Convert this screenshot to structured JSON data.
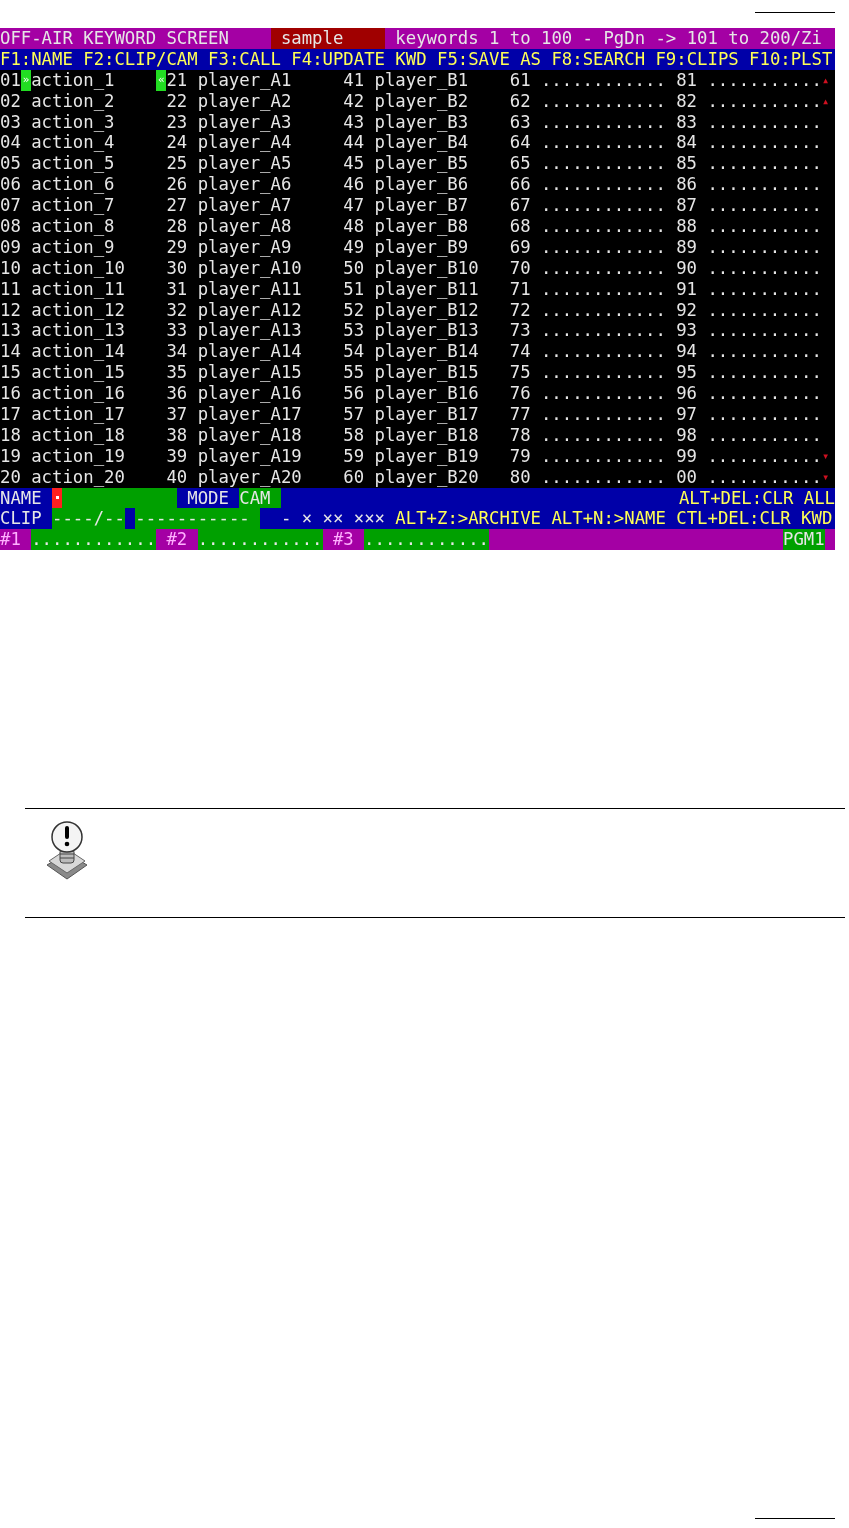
{
  "header": {
    "title": "OFF-AIR KEYWORD SCREEN",
    "file": "sample",
    "range": "keywords 1 to 100 - PgDn -> 101 to 200/Zi"
  },
  "function_keys": "F1:NAME F2:CLIP/CAM F3:CALL F4:UPDATE KWD F5:SAVE AS F8:SEARCH F9:CLIPS F10:PLST",
  "keyword_rows": [
    {
      "scroll_mark": "▴",
      "cells": [
        {
          "num": "01",
          "cursor_after": "»",
          "text": "action_1"
        },
        {
          "cursor_before": "«",
          "num": "21",
          "text": "player_A1"
        },
        {
          "num": "41",
          "text": "player_B1"
        },
        {
          "num": "61",
          "text": "............"
        },
        {
          "num": "81",
          "text": "..........."
        }
      ]
    },
    {
      "scroll_mark": "▴",
      "cells": [
        {
          "num": "02",
          "text": "action_2"
        },
        {
          "num": "22",
          "text": "player_A2"
        },
        {
          "num": "42",
          "text": "player_B2"
        },
        {
          "num": "62",
          "text": "............"
        },
        {
          "num": "82",
          "text": "..........."
        }
      ]
    },
    {
      "cells": [
        {
          "num": "03",
          "text": "action_3"
        },
        {
          "num": "23",
          "text": "player_A3"
        },
        {
          "num": "43",
          "text": "player_B3"
        },
        {
          "num": "63",
          "text": "............"
        },
        {
          "num": "83",
          "text": "..........."
        }
      ]
    },
    {
      "cells": [
        {
          "num": "04",
          "text": "action_4"
        },
        {
          "num": "24",
          "text": "player_A4"
        },
        {
          "num": "44",
          "text": "player_B4"
        },
        {
          "num": "64",
          "text": "............"
        },
        {
          "num": "84",
          "text": "..........."
        }
      ]
    },
    {
      "cells": [
        {
          "num": "05",
          "text": "action_5"
        },
        {
          "num": "25",
          "text": "player_A5"
        },
        {
          "num": "45",
          "text": "player_B5"
        },
        {
          "num": "65",
          "text": "............"
        },
        {
          "num": "85",
          "text": "..........."
        }
      ]
    },
    {
      "cells": [
        {
          "num": "06",
          "text": "action_6"
        },
        {
          "num": "26",
          "text": "player_A6"
        },
        {
          "num": "46",
          "text": "player_B6"
        },
        {
          "num": "66",
          "text": "............"
        },
        {
          "num": "86",
          "text": "..........."
        }
      ]
    },
    {
      "cells": [
        {
          "num": "07",
          "text": "action_7"
        },
        {
          "num": "27",
          "text": "player_A7"
        },
        {
          "num": "47",
          "text": "player_B7"
        },
        {
          "num": "67",
          "text": "............"
        },
        {
          "num": "87",
          "text": "..........."
        }
      ]
    },
    {
      "cells": [
        {
          "num": "08",
          "text": "action_8"
        },
        {
          "num": "28",
          "text": "player_A8"
        },
        {
          "num": "48",
          "text": "player_B8"
        },
        {
          "num": "68",
          "text": "............"
        },
        {
          "num": "88",
          "text": "..........."
        }
      ]
    },
    {
      "cells": [
        {
          "num": "09",
          "text": "action_9"
        },
        {
          "num": "29",
          "text": "player_A9"
        },
        {
          "num": "49",
          "text": "player_B9"
        },
        {
          "num": "69",
          "text": "............"
        },
        {
          "num": "89",
          "text": "..........."
        }
      ]
    },
    {
      "cells": [
        {
          "num": "10",
          "text": "action_10"
        },
        {
          "num": "30",
          "text": "player_A10"
        },
        {
          "num": "50",
          "text": "player_B10"
        },
        {
          "num": "70",
          "text": "............"
        },
        {
          "num": "90",
          "text": "..........."
        }
      ]
    },
    {
      "cells": [
        {
          "num": "11",
          "text": "action_11"
        },
        {
          "num": "31",
          "text": "player_A11"
        },
        {
          "num": "51",
          "text": "player_B11"
        },
        {
          "num": "71",
          "text": "............"
        },
        {
          "num": "91",
          "text": "..........."
        }
      ]
    },
    {
      "cells": [
        {
          "num": "12",
          "text": "action_12"
        },
        {
          "num": "32",
          "text": "player_A12"
        },
        {
          "num": "52",
          "text": "player_B12"
        },
        {
          "num": "72",
          "text": "............"
        },
        {
          "num": "92",
          "text": "..........."
        }
      ]
    },
    {
      "cells": [
        {
          "num": "13",
          "text": "action_13"
        },
        {
          "num": "33",
          "text": "player_A13"
        },
        {
          "num": "53",
          "text": "player_B13"
        },
        {
          "num": "73",
          "text": "............"
        },
        {
          "num": "93",
          "text": "..........."
        }
      ]
    },
    {
      "cells": [
        {
          "num": "14",
          "text": "action_14"
        },
        {
          "num": "34",
          "text": "player_A14"
        },
        {
          "num": "54",
          "text": "player_B14"
        },
        {
          "num": "74",
          "text": "............"
        },
        {
          "num": "94",
          "text": "..........."
        }
      ]
    },
    {
      "cells": [
        {
          "num": "15",
          "text": "action_15"
        },
        {
          "num": "35",
          "text": "player_A15"
        },
        {
          "num": "55",
          "text": "player_B15"
        },
        {
          "num": "75",
          "text": "............"
        },
        {
          "num": "95",
          "text": "..........."
        }
      ]
    },
    {
      "cells": [
        {
          "num": "16",
          "text": "action_16"
        },
        {
          "num": "36",
          "text": "player_A16"
        },
        {
          "num": "56",
          "text": "player_B16"
        },
        {
          "num": "76",
          "text": "............"
        },
        {
          "num": "96",
          "text": "..........."
        }
      ]
    },
    {
      "cells": [
        {
          "num": "17",
          "text": "action_17"
        },
        {
          "num": "37",
          "text": "player_A17"
        },
        {
          "num": "57",
          "text": "player_B17"
        },
        {
          "num": "77",
          "text": "............"
        },
        {
          "num": "97",
          "text": "..........."
        }
      ]
    },
    {
      "cells": [
        {
          "num": "18",
          "text": "action_18"
        },
        {
          "num": "38",
          "text": "player_A18"
        },
        {
          "num": "58",
          "text": "player_B18"
        },
        {
          "num": "78",
          "text": "............"
        },
        {
          "num": "98",
          "text": "..........."
        }
      ]
    },
    {
      "scroll_mark": "▾",
      "cells": [
        {
          "num": "19",
          "text": "action_19"
        },
        {
          "num": "39",
          "text": "player_A19"
        },
        {
          "num": "59",
          "text": "player_B19"
        },
        {
          "num": "79",
          "text": "............"
        },
        {
          "num": "99",
          "text": "..........."
        }
      ]
    },
    {
      "scroll_mark": "▾",
      "cells": [
        {
          "num": "20",
          "text": "action_20"
        },
        {
          "num": "40",
          "text": "player_A20"
        },
        {
          "num": "60",
          "text": "player_B20"
        },
        {
          "num": "80",
          "text": "............"
        },
        {
          "num": "00",
          "text": "..........."
        }
      ]
    }
  ],
  "name_line": {
    "label": "NAME",
    "mode_label": "MODE",
    "mode": "CAM",
    "hint": "ALT+DEL:CLR ALL"
  },
  "clip_line": {
    "label": "CLIP",
    "clip": "----/--",
    "cam": "-----------",
    "ratings": "- × ×× ×××",
    "hints": "ALT+Z:>ARCHIVE ALT+N:>NAME CTL+DEL:CLR KWD"
  },
  "slots": [
    {
      "label": "#1",
      "value": "............"
    },
    {
      "label": "#2",
      "value": "............"
    },
    {
      "label": "#3",
      "value": "............"
    }
  ],
  "program": "PGM1"
}
